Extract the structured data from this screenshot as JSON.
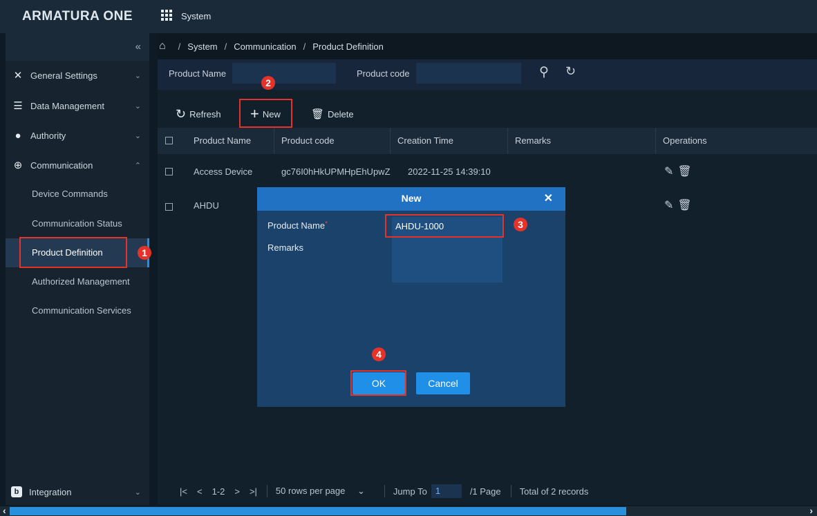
{
  "app": {
    "logo": "ARMATURA ONE",
    "module": "System"
  },
  "sidebar": {
    "collapse_glyph": "«",
    "groups": [
      {
        "label": "General Settings",
        "icon": "tools-icon"
      },
      {
        "label": "Data Management",
        "icon": "database-icon"
      },
      {
        "label": "Authority",
        "icon": "users-icon"
      },
      {
        "label": "Communication",
        "icon": "globe-icon"
      }
    ],
    "communication_items": [
      "Device Commands",
      "Communication Status",
      "Product Definition",
      "Authorized Management",
      "Communication Services"
    ],
    "active_item": "Product Definition",
    "bottom_group": {
      "label": "Integration",
      "icon": "integration-icon"
    }
  },
  "breadcrumb": [
    "System",
    "Communication",
    "Product Definition"
  ],
  "filter": {
    "product_name_label": "Product Name",
    "product_name_value": "",
    "product_code_label": "Product code",
    "product_code_value": ""
  },
  "toolbar": {
    "refresh": "Refresh",
    "new": "New",
    "delete": "Delete"
  },
  "table": {
    "columns": [
      "Product Name",
      "Product code",
      "Creation Time",
      "Remarks",
      "Operations"
    ],
    "rows": [
      {
        "name": "Access Device",
        "code": "gc76I0hHkUPMHpEhUpwZ",
        "time": "2022-11-25 14:39:10",
        "remarks": ""
      },
      {
        "name": "AHDU",
        "code": "",
        "time": "",
        "remarks": ""
      }
    ]
  },
  "pagination": {
    "range": "1-2",
    "rows_per_page": "50 rows per page",
    "jump_label": "Jump To",
    "jump_value": "1",
    "pages": "/1 Page",
    "total": "Total of 2 records"
  },
  "modal": {
    "title": "New",
    "product_name_label": "Product Name",
    "required_mark": "*",
    "product_name_value": "AHDU-1000",
    "remarks_label": "Remarks",
    "remarks_value": "",
    "ok": "OK",
    "cancel": "Cancel"
  },
  "annotations": {
    "step1": "1",
    "step2": "2",
    "step3": "3",
    "step4": "4",
    "color": "#e5332a"
  },
  "colors": {
    "accent": "#1f8fe8",
    "modal_header": "#2272c3",
    "modal_body": "#1a426a",
    "background": "#0e1a24"
  }
}
